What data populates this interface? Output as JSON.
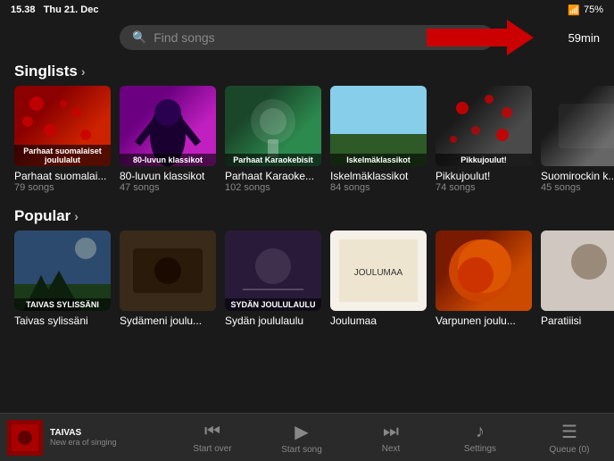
{
  "statusBar": {
    "time": "15.38",
    "day": "Thu 21. Dec",
    "battery": "75%",
    "timeBadge": "59min"
  },
  "search": {
    "placeholder": "Find songs"
  },
  "sections": [
    {
      "id": "singlists",
      "label": "Singlists",
      "items": [
        {
          "title": "Parhaat suomalai...",
          "subtitle": "79 songs",
          "overlayLabel": "Parhaat suomalaiset joululalut",
          "colorClass": "img-christmas1"
        },
        {
          "title": "80-luvun klassikot",
          "subtitle": "47 songs",
          "overlayLabel": "80-luvun klassikot",
          "colorClass": "img-80s"
        },
        {
          "title": "Parhaat Karaoke...",
          "subtitle": "102 songs",
          "overlayLabel": "Parhaat Karaokebisit",
          "colorClass": "img-karaoke"
        },
        {
          "title": "Iskelmäklassikot",
          "subtitle": "84 songs",
          "overlayLabel": "Iskelmäklassikot",
          "colorClass": "img-iskelma"
        },
        {
          "title": "Pikkujoulut!",
          "subtitle": "74 songs",
          "overlayLabel": "Pikkujoulut!",
          "colorClass": "img-pikkujoulut"
        },
        {
          "title": "Suomirockin k...",
          "subtitle": "45 songs",
          "overlayLabel": "",
          "colorClass": "img-suomirock"
        }
      ]
    },
    {
      "id": "popular",
      "label": "Popular",
      "items": [
        {
          "title": "Taivas sylissäni",
          "subtitle": "",
          "overlayLabel": "TAIVAS SYLISSÄNI",
          "colorClass": "img-taivas"
        },
        {
          "title": "Sydämeni joulu...",
          "subtitle": "",
          "overlayLabel": "",
          "colorClass": "img-sydameni"
        },
        {
          "title": "Sydän joululaulu",
          "subtitle": "",
          "overlayLabel": "SYDAN JOULULAULU",
          "colorClass": "img-sydans"
        },
        {
          "title": "Joulumaa",
          "subtitle": "",
          "overlayLabel": "JOULUMAA",
          "colorClass": "img-joulumaa"
        },
        {
          "title": "Varpunen joulu...",
          "subtitle": "",
          "overlayLabel": "",
          "colorClass": "img-varpunen"
        },
        {
          "title": "Paratiiisi",
          "subtitle": "",
          "overlayLabel": "",
          "colorClass": "img-paratiiisi"
        }
      ]
    }
  ],
  "tabBar": {
    "nowPlaying": {
      "title": "TAIVAS",
      "subtitle": "New era of singing"
    },
    "tabs": [
      {
        "id": "now-playing",
        "label": "",
        "icon": "♪"
      },
      {
        "id": "start-over",
        "label": "Start over",
        "icon": "⏮"
      },
      {
        "id": "start-song",
        "label": "Start song",
        "icon": "▶"
      },
      {
        "id": "next",
        "label": "Next",
        "icon": "⏭"
      },
      {
        "id": "settings",
        "label": "Settings",
        "icon": "♪"
      },
      {
        "id": "queue",
        "label": "Queue (0)",
        "icon": "☰"
      }
    ]
  }
}
